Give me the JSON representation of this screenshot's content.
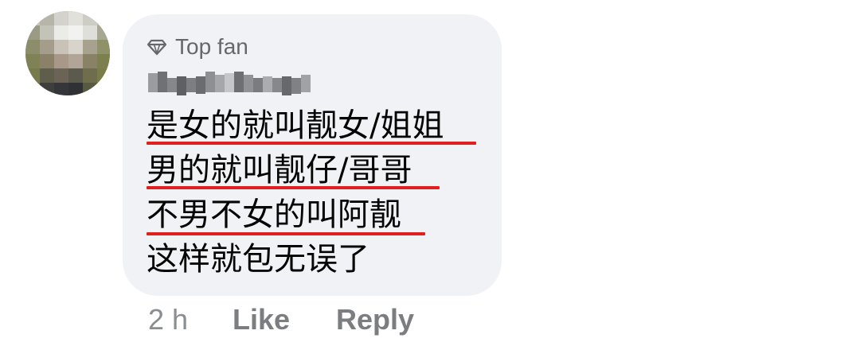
{
  "comment": {
    "badge_label": "Top fan",
    "badge_icon": "diamond-icon",
    "lines": [
      "是女的就叫靓女/姐姐",
      "男的就叫靓仔/哥哥",
      "不男不女的叫阿靓",
      "这样就包无误了"
    ],
    "underline_color": "#e0201f",
    "bubble_color": "#f0f2f5"
  },
  "actions": {
    "time": "2 h",
    "like_label": "Like",
    "reply_label": "Reply"
  }
}
